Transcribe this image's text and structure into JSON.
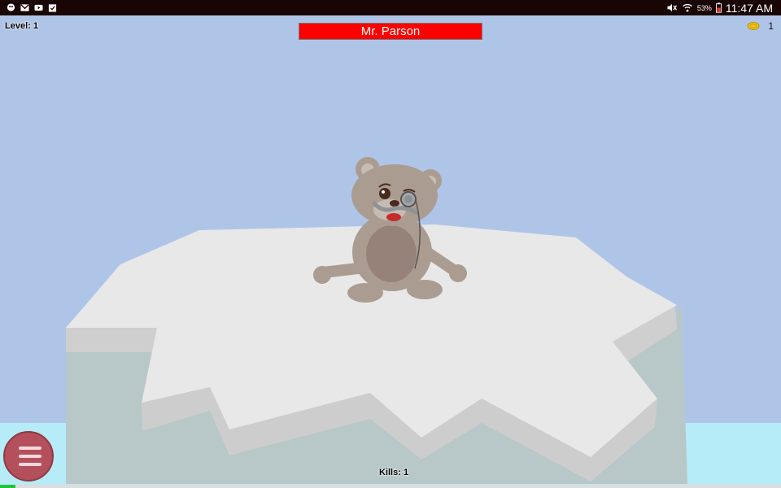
{
  "status_bar": {
    "icons": [
      "hangouts-icon",
      "gmail-icon",
      "youtube-icon",
      "clipboard-icon"
    ],
    "right_icons": [
      "mute-icon",
      "wifi-icon",
      "battery-icon"
    ],
    "battery": "53%",
    "time": "11:47 AM"
  },
  "hud": {
    "level": "Level: 1",
    "boss_name": "Mr. Parson",
    "coins": "1",
    "kills": "Kills: 1",
    "progress_fraction": 0.02
  },
  "colors": {
    "sky": "#afc5e8",
    "boss_bar": "#ff0000",
    "menu_button": "#b4505c",
    "water": "#b6ecf7",
    "bear": "#ab9c91",
    "progress": "#22c33a"
  }
}
